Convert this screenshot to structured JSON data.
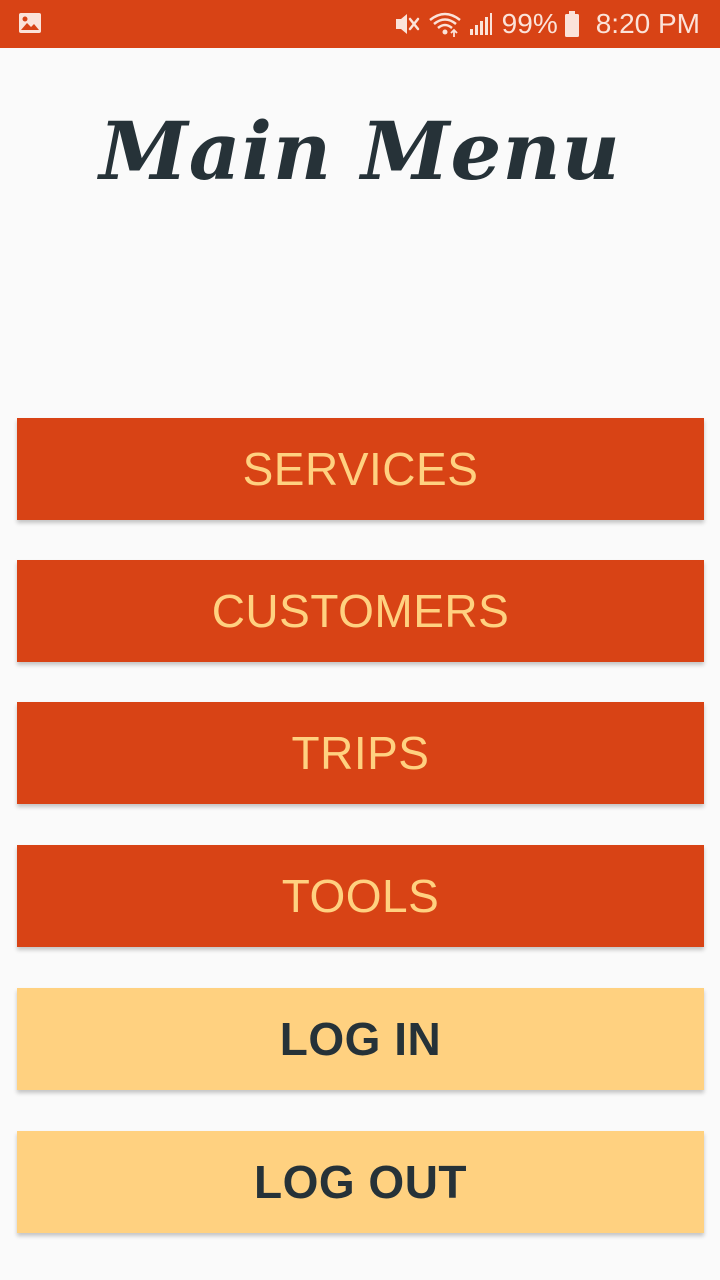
{
  "status_bar": {
    "notification_icon": "image-icon",
    "mute_icon": "vibrate-mute-icon",
    "wifi_icon": "wifi-icon",
    "signal_icon": "cell-signal-icon",
    "battery_percent": "99%",
    "battery_icon": "battery-icon",
    "time": "8:20 PM",
    "color": "#d84315"
  },
  "header": {
    "title": "Main Menu"
  },
  "menu": {
    "services_label": "SERVICES",
    "customers_label": "CUSTOMERS",
    "trips_label": "TRIPS",
    "tools_label": "TOOLS",
    "login_label": "LOG IN",
    "logout_label": "LOG OUT"
  },
  "colors": {
    "primary": "#d84315",
    "primary_text": "#ffd180",
    "secondary": "#ffd180",
    "secondary_text": "#263238",
    "title": "#263238",
    "background": "#fafafa"
  }
}
